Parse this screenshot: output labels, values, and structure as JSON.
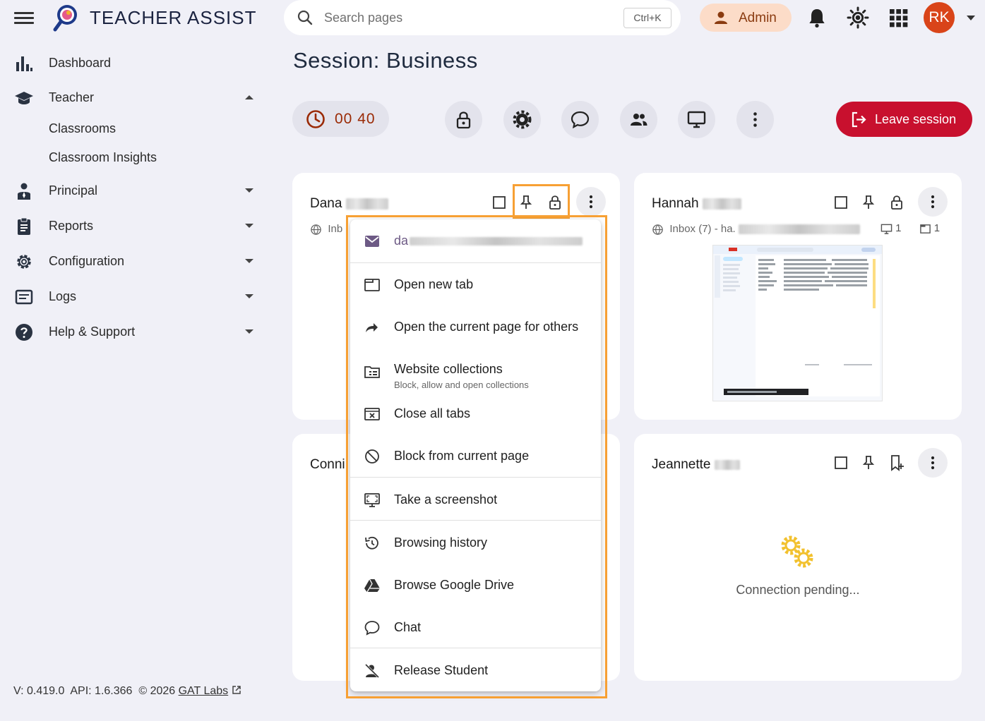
{
  "header": {
    "brand": "TEACHER ASSIST",
    "search_placeholder": "Search pages",
    "search_shortcut": "Ctrl+K",
    "role_label": "Admin",
    "avatar_initials": "RK"
  },
  "sidebar": {
    "items": [
      {
        "label": "Dashboard"
      },
      {
        "label": "Teacher"
      },
      {
        "label": "Principal"
      },
      {
        "label": "Reports"
      },
      {
        "label": "Configuration"
      },
      {
        "label": "Logs"
      },
      {
        "label": "Help & Support"
      }
    ],
    "teacher_sub": [
      "Classrooms",
      "Classroom Insights"
    ],
    "footer": {
      "version": "V: 0.419.0",
      "api": "API: 1.6.366",
      "copyright": "© 2026",
      "link": "GAT Labs"
    }
  },
  "session": {
    "title": "Session: Business",
    "timer": "00 40",
    "leave_label": "Leave session"
  },
  "students": [
    {
      "first_name": "Dana",
      "tab_partial": "Inb"
    },
    {
      "first_name": "Hannah",
      "tab_title": "Inbox (7) - ha.",
      "windows": "1",
      "tabs": "1"
    },
    {
      "first_name": "Connie",
      "name_partial": "Conni"
    },
    {
      "first_name": "Jeannette",
      "status": "Connection pending..."
    }
  ],
  "menu": {
    "email_partial": "da",
    "items": [
      {
        "label": "Open new tab",
        "icon": "tab-icon"
      },
      {
        "label": "Open the current page for others",
        "icon": "share-forward-icon"
      },
      {
        "label": "Website collections",
        "sub": "Block, allow and open collections",
        "icon": "collection-folder-icon"
      },
      {
        "label": "Close all tabs",
        "icon": "close-tabs-icon"
      },
      {
        "label": "Block from current page",
        "icon": "block-icon"
      },
      {
        "label": "Take a screenshot",
        "icon": "screenshot-icon"
      },
      {
        "label": "Browsing history",
        "icon": "history-icon"
      },
      {
        "label": "Browse Google Drive",
        "icon": "drive-icon"
      },
      {
        "label": "Chat",
        "icon": "chat-bubble-icon"
      },
      {
        "label": "Release Student",
        "icon": "release-person-icon"
      }
    ]
  },
  "colors": {
    "accent_red": "#c8102e",
    "admin_bg": "#fcdcc8",
    "highlight": "#f7a034",
    "avatar": "#d94419"
  }
}
